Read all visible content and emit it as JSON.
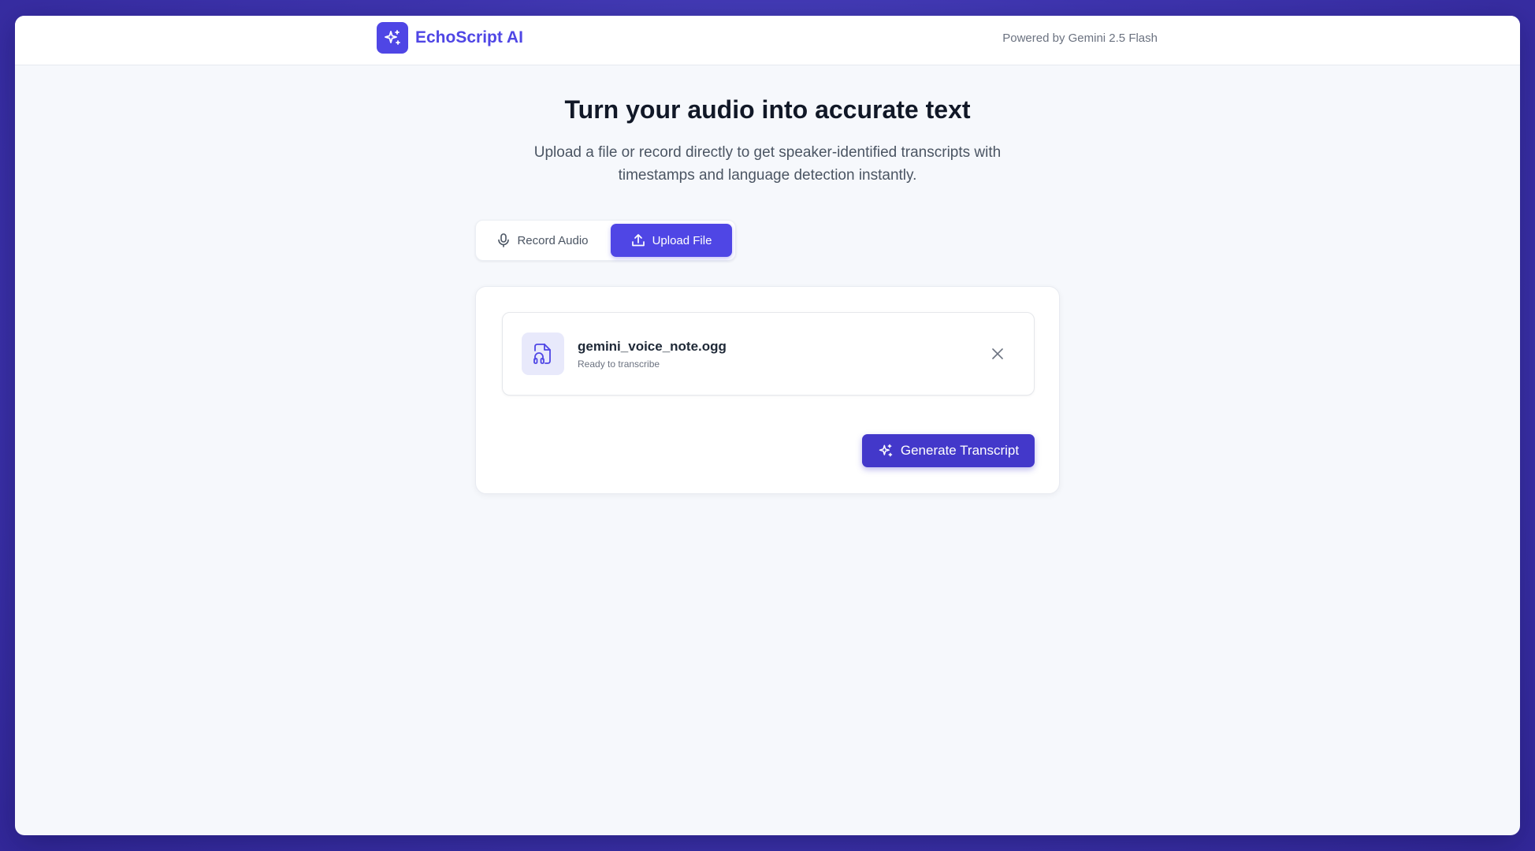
{
  "header": {
    "brand_name": "EchoScript AI",
    "logo_icon": "sparkles-icon",
    "powered_by": "Powered by Gemini 2.5 Flash"
  },
  "hero": {
    "title": "Turn your audio into accurate text",
    "subtitle": "Upload a file or record directly to get speaker-identified transcripts with timestamps and language detection instantly."
  },
  "tabs": [
    {
      "label": "Record Audio",
      "icon": "microphone-icon",
      "active": false
    },
    {
      "label": "Upload File",
      "icon": "upload-icon",
      "active": true
    }
  ],
  "file": {
    "name": "gemini_voice_note.ogg",
    "status": "Ready to transcribe",
    "icon": "audio-file-icon"
  },
  "actions": {
    "generate_label": "Generate Transcript",
    "generate_icon": "sparkles-icon",
    "remove_icon": "close-icon"
  },
  "colors": {
    "accent": "#4f46e5",
    "accent_dark": "#4338ca",
    "page_bg": "#f6f8fc",
    "frame_bg": "#3f35b0"
  }
}
